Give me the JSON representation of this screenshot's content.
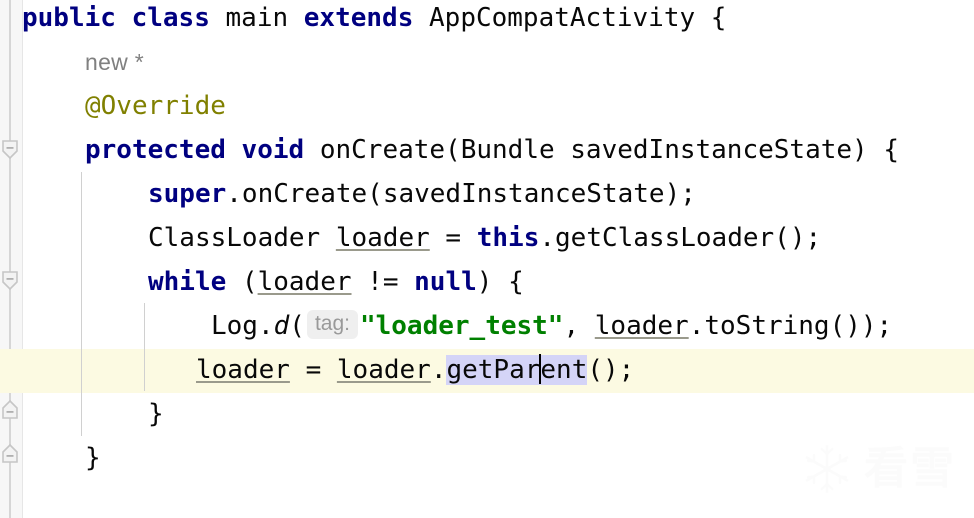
{
  "editor": {
    "language": "java",
    "background_color": "#ffffff",
    "gutter_color": "#f7f7f7",
    "current_line_highlight_color": "#fcfae2",
    "selection_color": "#d4d4f7",
    "keyword_color": "#000080",
    "string_color": "#008000",
    "annotation_color": "#808000",
    "hint_color": "#999999"
  },
  "code_lines": [
    {
      "index": 0,
      "tokens": [
        {
          "text": "public",
          "kind": "keyword"
        },
        {
          "text": " ",
          "kind": "plain"
        },
        {
          "text": "class",
          "kind": "keyword"
        },
        {
          "text": " main ",
          "kind": "plain"
        },
        {
          "text": "extends",
          "kind": "keyword"
        },
        {
          "text": " AppCompatActivity {",
          "kind": "plain"
        }
      ]
    },
    {
      "index": 1,
      "tokens": [
        {
          "text": "new *",
          "kind": "inlay-hint"
        }
      ]
    },
    {
      "index": 2,
      "tokens": [
        {
          "text": "@Override",
          "kind": "annotation"
        }
      ]
    },
    {
      "index": 3,
      "tokens": [
        {
          "text": "protected",
          "kind": "keyword"
        },
        {
          "text": " ",
          "kind": "plain"
        },
        {
          "text": "void",
          "kind": "keyword"
        },
        {
          "text": " onCreate(Bundle savedInstanceState) {",
          "kind": "plain"
        }
      ]
    },
    {
      "index": 4,
      "tokens": [
        {
          "text": "super",
          "kind": "keyword"
        },
        {
          "text": ".onCreate(savedInstanceState);",
          "kind": "plain"
        }
      ]
    },
    {
      "index": 5,
      "tokens": [
        {
          "text": "ClassLoader ",
          "kind": "plain"
        },
        {
          "text": "loader",
          "kind": "local-variable"
        },
        {
          "text": " = ",
          "kind": "plain"
        },
        {
          "text": "this",
          "kind": "keyword"
        },
        {
          "text": ".getClassLoader();",
          "kind": "plain"
        }
      ]
    },
    {
      "index": 6,
      "tokens": [
        {
          "text": "while",
          "kind": "keyword"
        },
        {
          "text": " (",
          "kind": "plain"
        },
        {
          "text": "loader",
          "kind": "local-variable"
        },
        {
          "text": " != ",
          "kind": "plain"
        },
        {
          "text": "null",
          "kind": "keyword"
        },
        {
          "text": ") {",
          "kind": "plain"
        }
      ]
    },
    {
      "index": 7,
      "tokens": [
        {
          "text": "Log.",
          "kind": "plain"
        },
        {
          "text": "d",
          "kind": "italic-method"
        },
        {
          "text": "( ",
          "kind": "plain"
        },
        {
          "text": "tag:",
          "kind": "parameter-hint"
        },
        {
          "text": "\"loader_test\"",
          "kind": "string"
        },
        {
          "text": ", ",
          "kind": "plain"
        },
        {
          "text": "loader",
          "kind": "local-variable"
        },
        {
          "text": ".toString());",
          "kind": "plain"
        }
      ]
    },
    {
      "index": 8,
      "tokens": [
        {
          "text": "loader",
          "kind": "local-variable"
        },
        {
          "text": " = ",
          "kind": "plain"
        },
        {
          "text": "loader",
          "kind": "local-variable"
        },
        {
          "text": ".",
          "kind": "plain"
        },
        {
          "text": "getParent",
          "kind": "selected"
        },
        {
          "text": "();",
          "kind": "plain"
        }
      ]
    },
    {
      "index": 9,
      "tokens": [
        {
          "text": "}",
          "kind": "plain"
        }
      ]
    },
    {
      "index": 10,
      "tokens": [
        {
          "text": "}",
          "kind": "plain"
        }
      ]
    }
  ],
  "line_text": {
    "l0_a": "public",
    "l0_b": " ",
    "l0_c": "class",
    "l0_d": " main ",
    "l0_e": "extends",
    "l0_f": " AppCompatActivity {",
    "l1_inlay": "new *",
    "l2_anno": "@Override",
    "l3_a": "protected",
    "l3_b": " ",
    "l3_c": "void",
    "l3_d": " onCreate(Bundle savedInstanceState) {",
    "l4_a": "super",
    "l4_b": ".onCreate(savedInstanceState);",
    "l5_a": "ClassLoader ",
    "l5_b": "loader",
    "l5_c": " = ",
    "l5_d": "this",
    "l5_e": ".getClassLoader();",
    "l6_a": "while",
    "l6_b": " (",
    "l6_c": "loader",
    "l6_d": " != ",
    "l6_e": "null",
    "l6_f": ") {",
    "l7_a": "Log.",
    "l7_b": "d",
    "l7_c": "(",
    "l7_hint": "tag:",
    "l7_d": "\"loader_test\"",
    "l7_e": ", ",
    "l7_f": "loader",
    "l7_g": ".toString());",
    "l8_a": "loader",
    "l8_b": " = ",
    "l8_c": "loader",
    "l8_d": ".",
    "l8_sel1": "getPar",
    "l8_sel2": "ent",
    "l8_e": "();",
    "l9": "}",
    "l10": "}"
  },
  "gutter": {
    "fold_markers": [
      {
        "type": "fold-collapse-start",
        "line": 3
      },
      {
        "type": "fold-collapse-start",
        "line": 6
      },
      {
        "type": "fold-collapse-end",
        "line": 9
      },
      {
        "type": "fold-collapse-end",
        "line": 10
      }
    ]
  },
  "watermark": {
    "text": "看雪",
    "icon": "snowflake-icon",
    "color": "#fbfbfb"
  }
}
